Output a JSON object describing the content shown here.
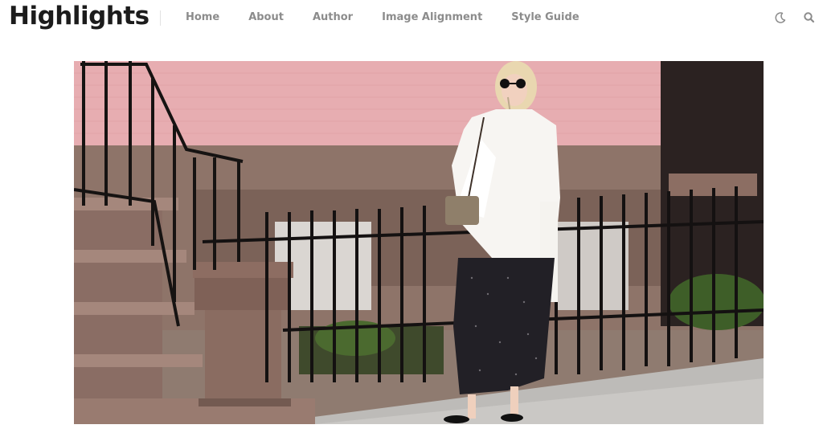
{
  "site": {
    "title": "Highlights"
  },
  "nav": {
    "items": [
      {
        "label": "Home"
      },
      {
        "label": "About"
      },
      {
        "label": "Author"
      },
      {
        "label": "Image Alignment"
      },
      {
        "label": "Style Guide"
      }
    ]
  },
  "icons": {
    "theme_toggle": "moon-icon",
    "search": "search-icon"
  },
  "hero": {
    "image": "featured-photo"
  },
  "colors": {
    "logo": "#1c1c1c",
    "nav_text": "#8c8c8c",
    "brick": "#e7adb1"
  }
}
